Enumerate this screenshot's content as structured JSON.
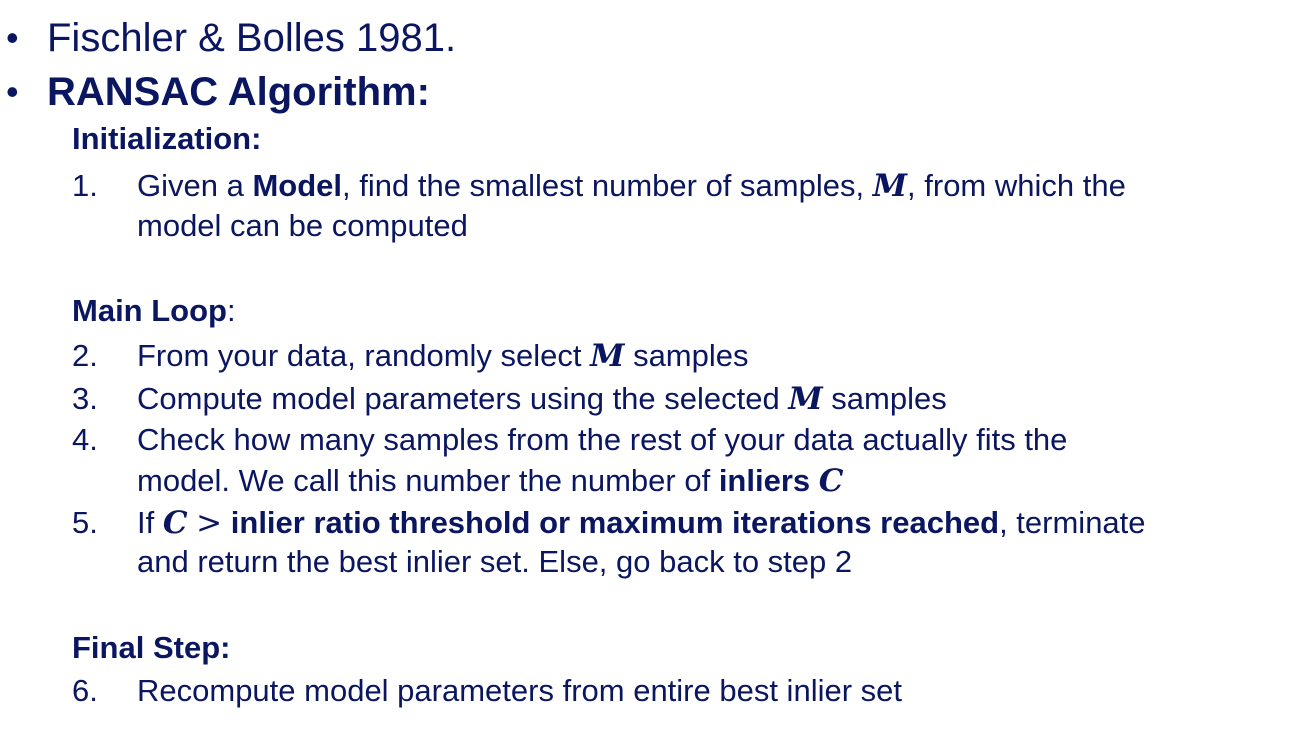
{
  "bullets": {
    "mark": "•",
    "reference": "Fischler & Bolles 1981.",
    "algorithm_title": "RANSAC Algorithm:"
  },
  "initialization": {
    "heading": "Initialization:",
    "steps": [
      {
        "number": "1.",
        "line1_before": "Given a ",
        "line1_bold": "Model",
        "line1_middle": ", find the smallest number of samples, ",
        "line1_var": "M",
        "line1_after": ", from which the",
        "line2": "model can be computed"
      }
    ]
  },
  "main_loop": {
    "heading": "Main Loop",
    "heading_colon": ":",
    "steps": [
      {
        "number": "2.",
        "before": "From your data, randomly select ",
        "var": "M",
        "after": " samples"
      },
      {
        "number": "3.",
        "before": "Compute model parameters using the selected ",
        "var": "M",
        "after": " samples"
      },
      {
        "number": "4.",
        "line1": "Check how many samples from the rest of your data actually fits the",
        "line2_before": "model. We call this number the number of ",
        "line2_bold": "inliers",
        "line2_var": "C"
      },
      {
        "number": "5.",
        "line1_before": "If ",
        "line1_var": "C",
        "line1_op": ">",
        "line1_bold": "inlier ratio threshold or maximum iterations reached",
        "line1_after": ", terminate",
        "line2": "and return the best inlier set.  Else, go back to step 2"
      }
    ]
  },
  "final_step": {
    "heading": "Final Step:",
    "steps": [
      {
        "number": "6.",
        "text": "Recompute model parameters from entire best inlier set"
      }
    ]
  },
  "colors": {
    "text": "#0b1660",
    "background": "#ffffff"
  }
}
